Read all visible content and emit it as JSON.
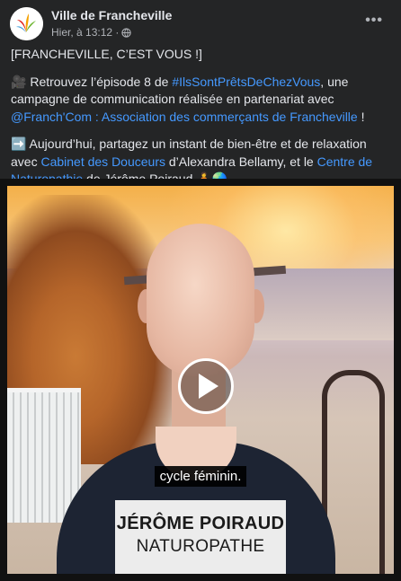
{
  "page": {
    "name": "Ville de Francheville",
    "timestamp": "Hier, à 13:12 ·"
  },
  "colors": {
    "link": "#4599ff",
    "background": "#242526",
    "text": "#e4e6eb"
  },
  "post": {
    "line1": "[FRANCHEVILLE, C’EST VOUS !]",
    "p2_emoji": "🎥",
    "p2_a": " Retrouvez l’épisode 8 de ",
    "p2_hashtag": "#IlsSontPrêtsDeChezVous",
    "p2_b": ", une campagne de communication réalisée en partenariat avec ",
    "p2_mention": "@Franch'Com : Association des commerçants de Francheville",
    "p2_c": " !",
    "p3_emoji": "➡️",
    "p3_a": " Aujourd’hui, partagez un instant de bien-être et de relaxation avec ",
    "p3_link1": "Cabinet des Douceurs",
    "p3_b": " d’Alexandra Bellamy, et le ",
    "p3_link2": "Centre de Naturopathie",
    "p3_c": " de Jérôme Poiraud.",
    "p3_emoji_end": "🧘🌏"
  },
  "video": {
    "subtitle": "cycle féminin.",
    "person_name": "JÉRÔME POIRAUD",
    "person_title": "NATUROPATHE"
  },
  "icons": [
    "page-logo-icon",
    "globe-icon",
    "more-options-icon",
    "play-icon"
  ]
}
